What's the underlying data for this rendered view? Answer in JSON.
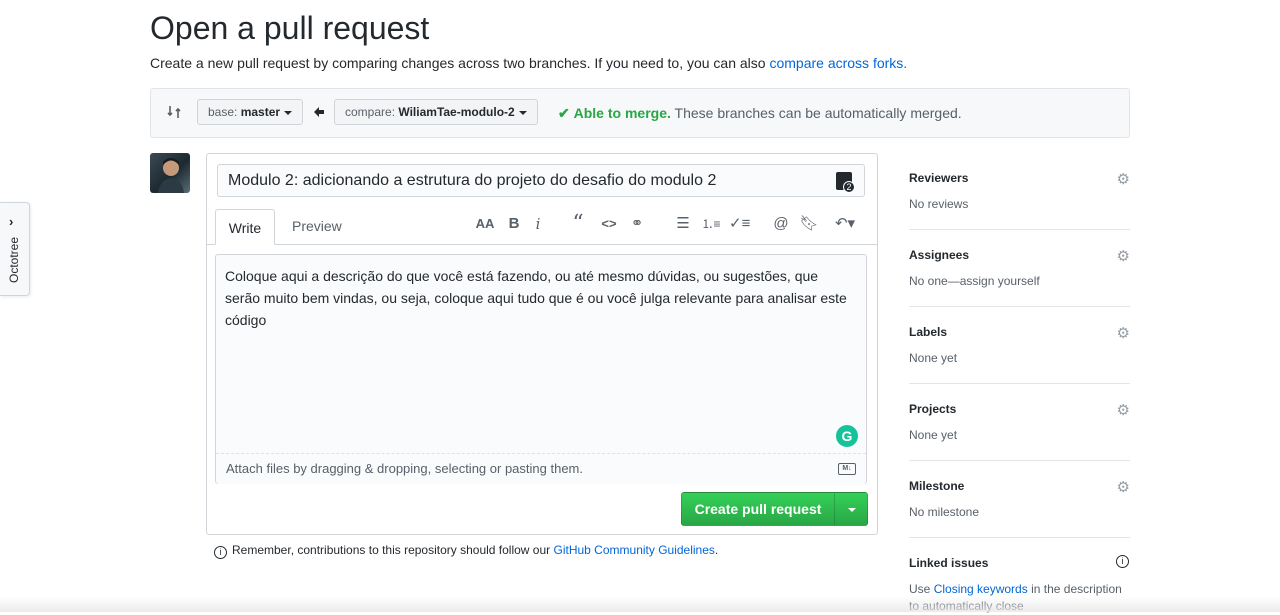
{
  "octotree": {
    "label": "Octotree"
  },
  "header": {
    "title": "Open a pull request",
    "subtitle": "Create a new pull request by comparing changes across two branches. If you need to, you can also",
    "subtitle_link": "compare across forks."
  },
  "range": {
    "base_key": "base:",
    "base_value": "master",
    "compare_key": "compare:",
    "compare_value": "WiliamTae-modulo-2",
    "merge_ok": "Able to merge.",
    "merge_msg": "These branches can be automatically merged."
  },
  "form": {
    "title_value": "Modulo 2: adicionando a estrutura do projeto do desafio do modulo 2",
    "tab_write": "Write",
    "tab_preview": "Preview",
    "body_value": "Coloque aqui a descrição do que você está fazendo, ou até mesmo dúvidas, ou sugestões, que serão muito bem vindas, ou seja, coloque aqui tudo que é ou você julga relevante para analisar este código",
    "attach_hint": "Attach files by dragging & dropping, selecting or pasting them.",
    "submit_label": "Create pull request"
  },
  "guidelines": {
    "text": "Remember, contributions to this repository should follow our",
    "link": "GitHub Community Guidelines",
    "end": "."
  },
  "sidebar": {
    "reviewers": {
      "label": "Reviewers",
      "value": "No reviews"
    },
    "assignees": {
      "label": "Assignees",
      "value": "No one—assign yourself"
    },
    "labels": {
      "label": "Labels",
      "value": "None yet"
    },
    "projects": {
      "label": "Projects",
      "value": "None yet"
    },
    "milestone": {
      "label": "Milestone",
      "value": "No milestone"
    },
    "linked": {
      "label": "Linked issues",
      "pre": "Use",
      "link": "Closing keywords",
      "post": "in the description to automatically close"
    }
  },
  "colors": {
    "accent": "#0366d6",
    "success": "#28a745"
  },
  "icons": [
    "git-compare-icon",
    "arrow-left-icon",
    "check-icon",
    "heading-icon",
    "bold-icon",
    "italic-icon",
    "quote-icon",
    "code-icon",
    "link-icon",
    "bullet-list-icon",
    "numbered-list-icon",
    "task-list-icon",
    "mention-icon",
    "bookmark-icon",
    "reply-icon",
    "gear-icon",
    "info-icon",
    "markdown-icon",
    "grammarly-icon"
  ]
}
